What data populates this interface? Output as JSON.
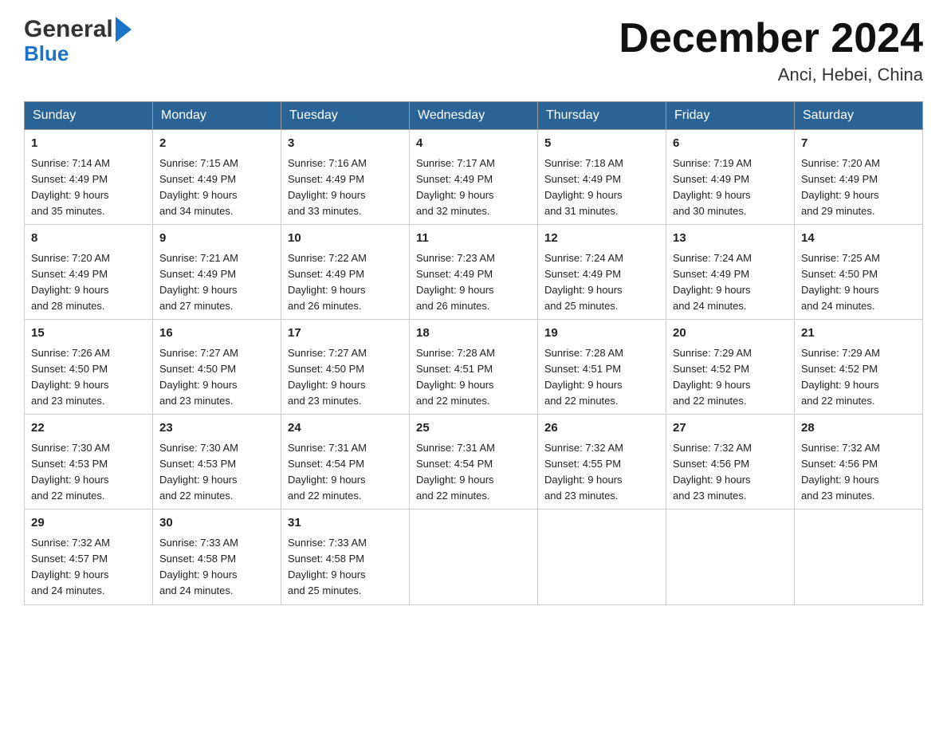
{
  "header": {
    "logo_line1": "General",
    "logo_line2": "Blue",
    "month_title": "December 2024",
    "location": "Anci, Hebei, China"
  },
  "days_of_week": [
    "Sunday",
    "Monday",
    "Tuesday",
    "Wednesday",
    "Thursday",
    "Friday",
    "Saturday"
  ],
  "weeks": [
    [
      {
        "day": "1",
        "sunrise": "7:14 AM",
        "sunset": "4:49 PM",
        "daylight": "9 hours and 35 minutes."
      },
      {
        "day": "2",
        "sunrise": "7:15 AM",
        "sunset": "4:49 PM",
        "daylight": "9 hours and 34 minutes."
      },
      {
        "day": "3",
        "sunrise": "7:16 AM",
        "sunset": "4:49 PM",
        "daylight": "9 hours and 33 minutes."
      },
      {
        "day": "4",
        "sunrise": "7:17 AM",
        "sunset": "4:49 PM",
        "daylight": "9 hours and 32 minutes."
      },
      {
        "day": "5",
        "sunrise": "7:18 AM",
        "sunset": "4:49 PM",
        "daylight": "9 hours and 31 minutes."
      },
      {
        "day": "6",
        "sunrise": "7:19 AM",
        "sunset": "4:49 PM",
        "daylight": "9 hours and 30 minutes."
      },
      {
        "day": "7",
        "sunrise": "7:20 AM",
        "sunset": "4:49 PM",
        "daylight": "9 hours and 29 minutes."
      }
    ],
    [
      {
        "day": "8",
        "sunrise": "7:20 AM",
        "sunset": "4:49 PM",
        "daylight": "9 hours and 28 minutes."
      },
      {
        "day": "9",
        "sunrise": "7:21 AM",
        "sunset": "4:49 PM",
        "daylight": "9 hours and 27 minutes."
      },
      {
        "day": "10",
        "sunrise": "7:22 AM",
        "sunset": "4:49 PM",
        "daylight": "9 hours and 26 minutes."
      },
      {
        "day": "11",
        "sunrise": "7:23 AM",
        "sunset": "4:49 PM",
        "daylight": "9 hours and 26 minutes."
      },
      {
        "day": "12",
        "sunrise": "7:24 AM",
        "sunset": "4:49 PM",
        "daylight": "9 hours and 25 minutes."
      },
      {
        "day": "13",
        "sunrise": "7:24 AM",
        "sunset": "4:49 PM",
        "daylight": "9 hours and 24 minutes."
      },
      {
        "day": "14",
        "sunrise": "7:25 AM",
        "sunset": "4:50 PM",
        "daylight": "9 hours and 24 minutes."
      }
    ],
    [
      {
        "day": "15",
        "sunrise": "7:26 AM",
        "sunset": "4:50 PM",
        "daylight": "9 hours and 23 minutes."
      },
      {
        "day": "16",
        "sunrise": "7:27 AM",
        "sunset": "4:50 PM",
        "daylight": "9 hours and 23 minutes."
      },
      {
        "day": "17",
        "sunrise": "7:27 AM",
        "sunset": "4:50 PM",
        "daylight": "9 hours and 23 minutes."
      },
      {
        "day": "18",
        "sunrise": "7:28 AM",
        "sunset": "4:51 PM",
        "daylight": "9 hours and 22 minutes."
      },
      {
        "day": "19",
        "sunrise": "7:28 AM",
        "sunset": "4:51 PM",
        "daylight": "9 hours and 22 minutes."
      },
      {
        "day": "20",
        "sunrise": "7:29 AM",
        "sunset": "4:52 PM",
        "daylight": "9 hours and 22 minutes."
      },
      {
        "day": "21",
        "sunrise": "7:29 AM",
        "sunset": "4:52 PM",
        "daylight": "9 hours and 22 minutes."
      }
    ],
    [
      {
        "day": "22",
        "sunrise": "7:30 AM",
        "sunset": "4:53 PM",
        "daylight": "9 hours and 22 minutes."
      },
      {
        "day": "23",
        "sunrise": "7:30 AM",
        "sunset": "4:53 PM",
        "daylight": "9 hours and 22 minutes."
      },
      {
        "day": "24",
        "sunrise": "7:31 AM",
        "sunset": "4:54 PM",
        "daylight": "9 hours and 22 minutes."
      },
      {
        "day": "25",
        "sunrise": "7:31 AM",
        "sunset": "4:54 PM",
        "daylight": "9 hours and 22 minutes."
      },
      {
        "day": "26",
        "sunrise": "7:32 AM",
        "sunset": "4:55 PM",
        "daylight": "9 hours and 23 minutes."
      },
      {
        "day": "27",
        "sunrise": "7:32 AM",
        "sunset": "4:56 PM",
        "daylight": "9 hours and 23 minutes."
      },
      {
        "day": "28",
        "sunrise": "7:32 AM",
        "sunset": "4:56 PM",
        "daylight": "9 hours and 23 minutes."
      }
    ],
    [
      {
        "day": "29",
        "sunrise": "7:32 AM",
        "sunset": "4:57 PM",
        "daylight": "9 hours and 24 minutes."
      },
      {
        "day": "30",
        "sunrise": "7:33 AM",
        "sunset": "4:58 PM",
        "daylight": "9 hours and 24 minutes."
      },
      {
        "day": "31",
        "sunrise": "7:33 AM",
        "sunset": "4:58 PM",
        "daylight": "9 hours and 25 minutes."
      },
      null,
      null,
      null,
      null
    ]
  ],
  "labels": {
    "sunrise": "Sunrise:",
    "sunset": "Sunset:",
    "daylight": "Daylight:"
  }
}
